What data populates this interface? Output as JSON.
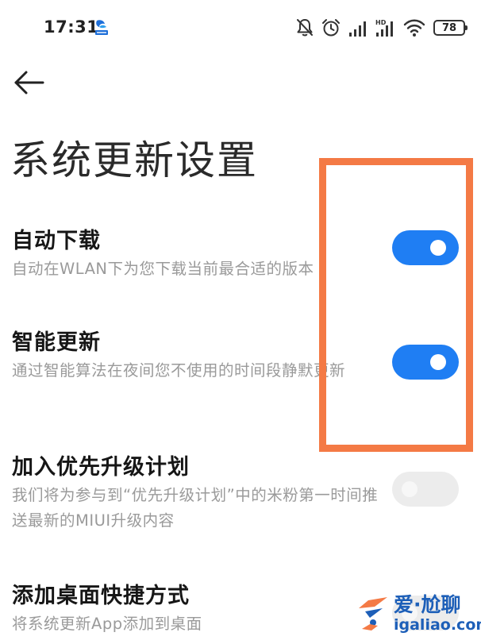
{
  "status_bar": {
    "time": "17:31",
    "app_icon": "baidu-netdisk-icon",
    "icons": [
      "mute-bell-icon",
      "alarm-icon",
      "signal-icon",
      "hd-signal-icon",
      "wifi-icon"
    ],
    "battery_level": "78"
  },
  "header": {
    "back_icon": "arrow-left-icon",
    "title": "系统更新设置"
  },
  "settings": [
    {
      "title": "自动下载",
      "description": "自动在WLAN下为您下载当前最合适的版本",
      "enabled": true
    },
    {
      "title": "智能更新",
      "description": "通过智能算法在夜间您不使用的时间段静默更新",
      "enabled": true
    },
    {
      "title": "加入优先升级计划",
      "description": "我们将为参与到“优先升级计划”中的米粉第一时间推送最新的MIUI升级内容",
      "enabled": false
    },
    {
      "title": "添加桌面快捷方式",
      "description": "将系统更新App添加到桌面",
      "enabled": false
    }
  ],
  "colors": {
    "toggle_on": "#1f7ef3",
    "toggle_off": "#ececec",
    "highlight": "#f47a45",
    "watermark": "#1d5fb8"
  },
  "watermark": {
    "title": "爱·尬聊",
    "url": "igaliao.com"
  }
}
